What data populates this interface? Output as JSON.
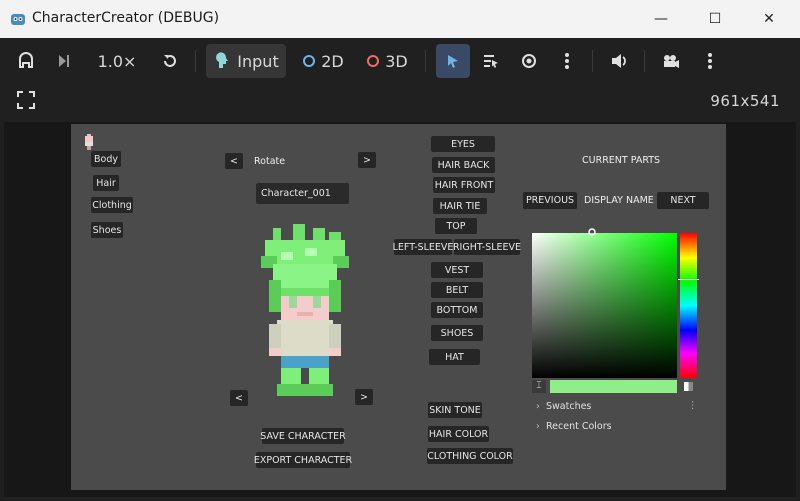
{
  "window": {
    "title": "CharacterCreator (DEBUG)"
  },
  "toolbar": {
    "speed": "1.0×",
    "input_label": "Input",
    "mode_2d": "2D",
    "mode_3d": "3D",
    "resolution": "961x541"
  },
  "game": {
    "category_buttons": [
      "Body",
      "Hair",
      "Clothing",
      "Shoes"
    ],
    "rotate_prev": "<",
    "rotate_label": "Rotate",
    "rotate_next": ">",
    "character_name": "Character_001",
    "preview_prev": "<",
    "preview_next": ">",
    "save_button": "SAVE CHARACTER",
    "export_button": "EXPORT CHARACTER",
    "part_buttons": [
      "EYES",
      "HAIR BACK",
      "HAIR FRONT",
      "HAIR TIE",
      "TOP",
      "LEFT-SLEEVE",
      "RIGHT-SLEEVE",
      "VEST",
      "BELT",
      "BOTTOM",
      "SHOES",
      "HAT"
    ],
    "color_buttons": [
      "SKIN TONE",
      "HAIR COLOR",
      "CLOTHING COLOR"
    ],
    "current_parts_title": "CURRENT PARTS",
    "previous_button": "PREVIOUS",
    "display_name": "DISPLAY NAME",
    "next_button": "NEXT",
    "picker": {
      "current_color": "#90ee88",
      "hue_color": "#00ff00",
      "swatches_label": "Swatches",
      "recent_label": "Recent Colors"
    }
  }
}
